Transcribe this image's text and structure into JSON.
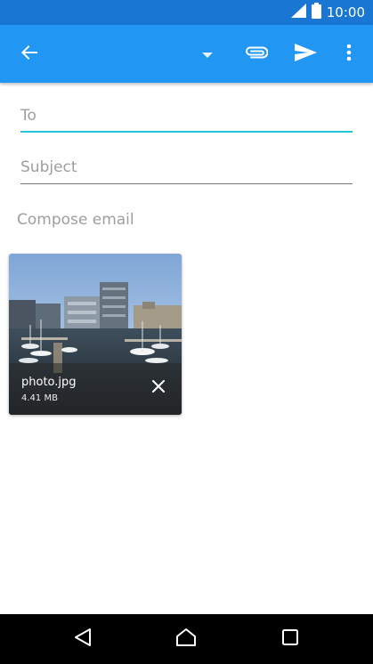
{
  "status_bar": {
    "time": "10:00",
    "icons": [
      "signal-icon",
      "battery-icon"
    ]
  },
  "toolbar": {
    "icons": [
      "back-arrow-icon",
      "dropdown-icon",
      "attach-icon",
      "send-icon",
      "more-vert-icon"
    ]
  },
  "compose_form": {
    "to_placeholder": "To",
    "subject_placeholder": "Subject",
    "body_placeholder": "Compose email"
  },
  "attachment": {
    "filename": "photo.jpg",
    "size": "4.41 MB",
    "remove_icon": "close-icon"
  },
  "nav_bar": {
    "icons": [
      "back-icon",
      "home-icon",
      "recents-icon"
    ]
  },
  "colors": {
    "status_bar": "#1976d2",
    "app_bar": "#2196f3",
    "focus_accent": "#26c6da",
    "hint_text": "#9e9e9e"
  }
}
